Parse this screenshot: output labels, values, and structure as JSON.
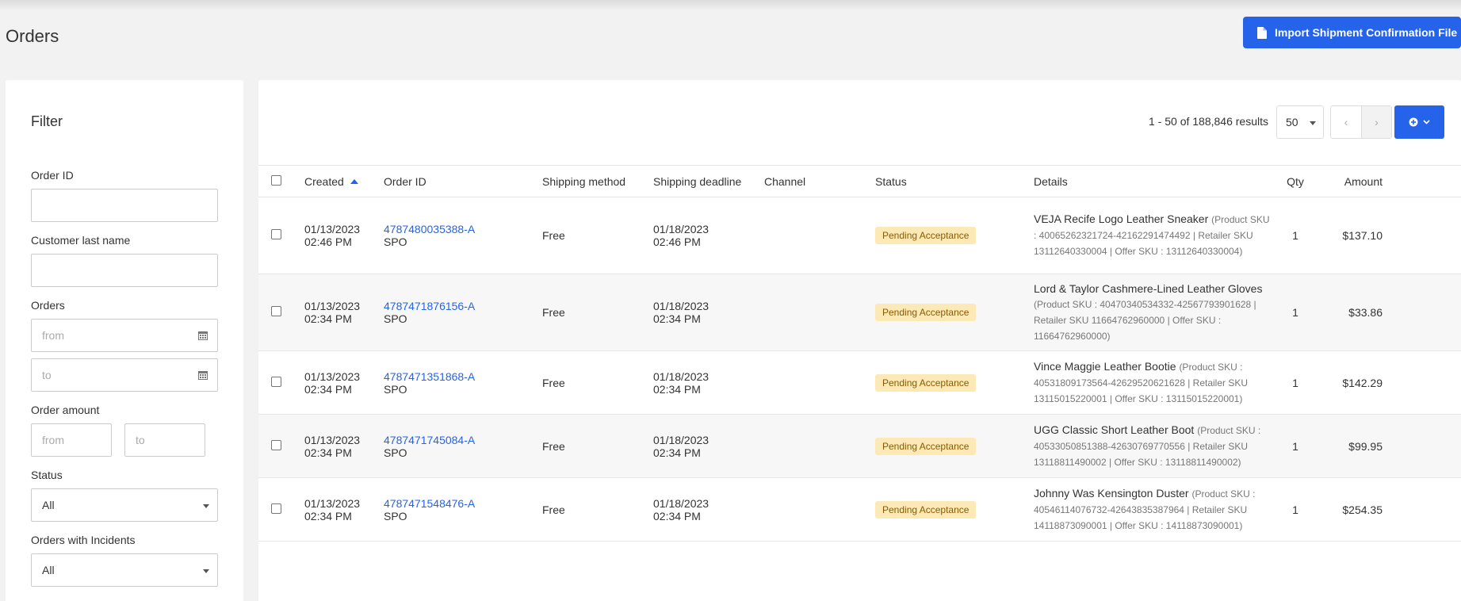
{
  "page": {
    "title": "Orders",
    "import_button_label": "Import Shipment Confirmation File",
    "icon_file": "file-icon"
  },
  "filter": {
    "title": "Filter",
    "order_id_label": "Order ID",
    "order_id_value": "",
    "customer_last_name_label": "Customer last name",
    "customer_last_name_value": "",
    "orders_label": "Orders",
    "orders_from_placeholder": "from",
    "orders_to_placeholder": "to",
    "order_amount_label": "Order amount",
    "amount_from_placeholder": "from",
    "amount_to_placeholder": "to",
    "status_label": "Status",
    "status_value": "All",
    "incidents_label": "Orders with Incidents",
    "incidents_value": "All"
  },
  "results": {
    "summary": "1 - 50 of 188,846 results",
    "per_page": "50",
    "prev": "‹",
    "next": "›"
  },
  "columns": {
    "created": "Created",
    "order_id": "Order ID",
    "shipping_method": "Shipping method",
    "shipping_deadline": "Shipping deadline",
    "channel": "Channel",
    "status": "Status",
    "details": "Details",
    "qty": "Qty",
    "amount": "Amount"
  },
  "orders": [
    {
      "created_date": "01/13/2023",
      "created_time": "02:46 PM",
      "order_id": "4787480035388-A",
      "order_type": "SPO",
      "shipping_method": "Free",
      "deadline_date": "01/18/2023",
      "deadline_time": "02:46 PM",
      "channel": "",
      "status": "Pending Acceptance",
      "product_name": "VEJA Recife Logo Leather Sneaker",
      "sku_text": "(Product SKU : 40065262321724-42162291474492 | Retailer SKU 13112640330004 | Offer SKU : 13112640330004)",
      "qty": "1",
      "amount": "$137.10"
    },
    {
      "created_date": "01/13/2023",
      "created_time": "02:34 PM",
      "order_id": "4787471876156-A",
      "order_type": "SPO",
      "shipping_method": "Free",
      "deadline_date": "01/18/2023",
      "deadline_time": "02:34 PM",
      "channel": "",
      "status": "Pending Acceptance",
      "product_name": "Lord & Taylor Cashmere-Lined Leather Gloves",
      "sku_text": "(Product SKU : 40470340534332-42567793901628 | Retailer SKU 11664762960000 | Offer SKU : 11664762960000)",
      "qty": "1",
      "amount": "$33.86"
    },
    {
      "created_date": "01/13/2023",
      "created_time": "02:34 PM",
      "order_id": "4787471351868-A",
      "order_type": "SPO",
      "shipping_method": "Free",
      "deadline_date": "01/18/2023",
      "deadline_time": "02:34 PM",
      "channel": "",
      "status": "Pending Acceptance",
      "product_name": "Vince Maggie Leather Bootie",
      "sku_text": "(Product SKU : 40531809173564-42629520621628 | Retailer SKU 13115015220001 | Offer SKU : 13115015220001)",
      "qty": "1",
      "amount": "$142.29"
    },
    {
      "created_date": "01/13/2023",
      "created_time": "02:34 PM",
      "order_id": "4787471745084-A",
      "order_type": "SPO",
      "shipping_method": "Free",
      "deadline_date": "01/18/2023",
      "deadline_time": "02:34 PM",
      "channel": "",
      "status": "Pending Acceptance",
      "product_name": "UGG Classic Short Leather Boot",
      "sku_text": "(Product SKU : 40533050851388-42630769770556 | Retailer SKU 13118811490002 | Offer SKU : 13118811490002)",
      "qty": "1",
      "amount": "$99.95"
    },
    {
      "created_date": "01/13/2023",
      "created_time": "02:34 PM",
      "order_id": "4787471548476-A",
      "order_type": "SPO",
      "shipping_method": "Free",
      "deadline_date": "01/18/2023",
      "deadline_time": "02:34 PM",
      "channel": "",
      "status": "Pending Acceptance",
      "product_name": "Johnny Was Kensington Duster",
      "sku_text": "(Product SKU : 40546114076732-42643835387964 | Retailer SKU 14118873090001 | Offer SKU : 14118873090001)",
      "qty": "1",
      "amount": "$254.35"
    }
  ],
  "colors": {
    "accent": "#2563eb",
    "badge_bg": "#fde9b5",
    "badge_text": "#8a5a00"
  }
}
